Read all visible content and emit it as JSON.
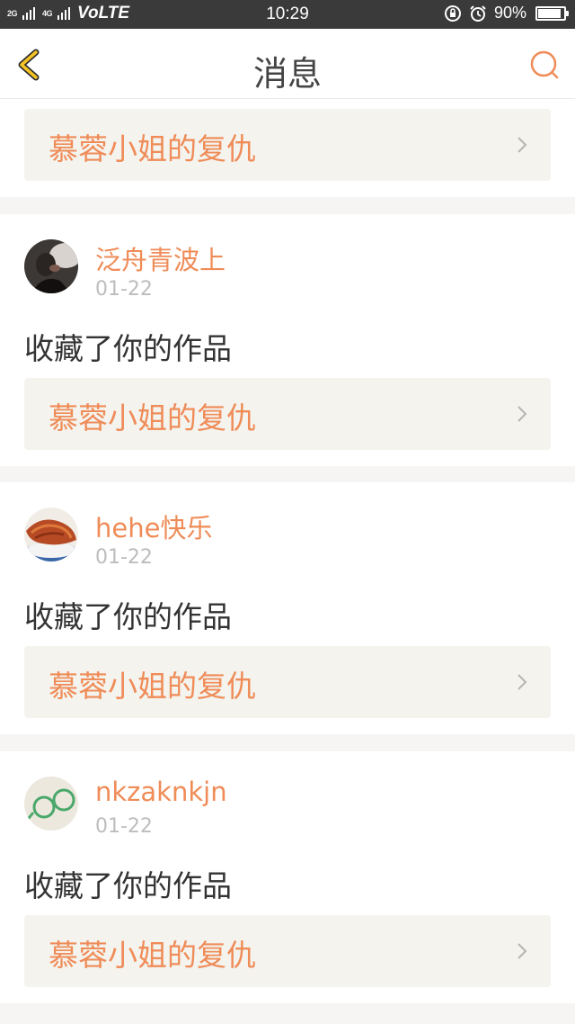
{
  "status_bar": {
    "signal_2g": "2G",
    "signal_4g": "4G",
    "volte": "VoLTE",
    "time": "10:29",
    "battery_text": "90%",
    "battery_level": 0.9
  },
  "header": {
    "title": "消息"
  },
  "messages": [
    {
      "work_title": "慕蓉小姐的复仇"
    },
    {
      "username": "泛舟青波上",
      "date": "01-22",
      "action": "收藏了你的作品",
      "work_title": "慕蓉小姐的复仇",
      "avatar_icon": "user-avatar"
    },
    {
      "username": "hehe快乐",
      "date": "01-22",
      "action": "收藏了你的作品",
      "work_title": "慕蓉小姐的复仇",
      "avatar_icon": "user-avatar"
    },
    {
      "username": "nkzaknkjn",
      "date": "01-22",
      "action": "收藏了你的作品",
      "work_title": "慕蓉小姐的复仇",
      "avatar_icon": "user-avatar"
    }
  ],
  "colors": {
    "accent": "#ef8c58",
    "back_icon": "#f5c324",
    "date": "#bdbdbd",
    "work_bg": "#f4f3ee"
  },
  "icons": {
    "back": "chevron-left-icon",
    "search": "search-icon",
    "work_arrow": "chevron-right-icon"
  }
}
